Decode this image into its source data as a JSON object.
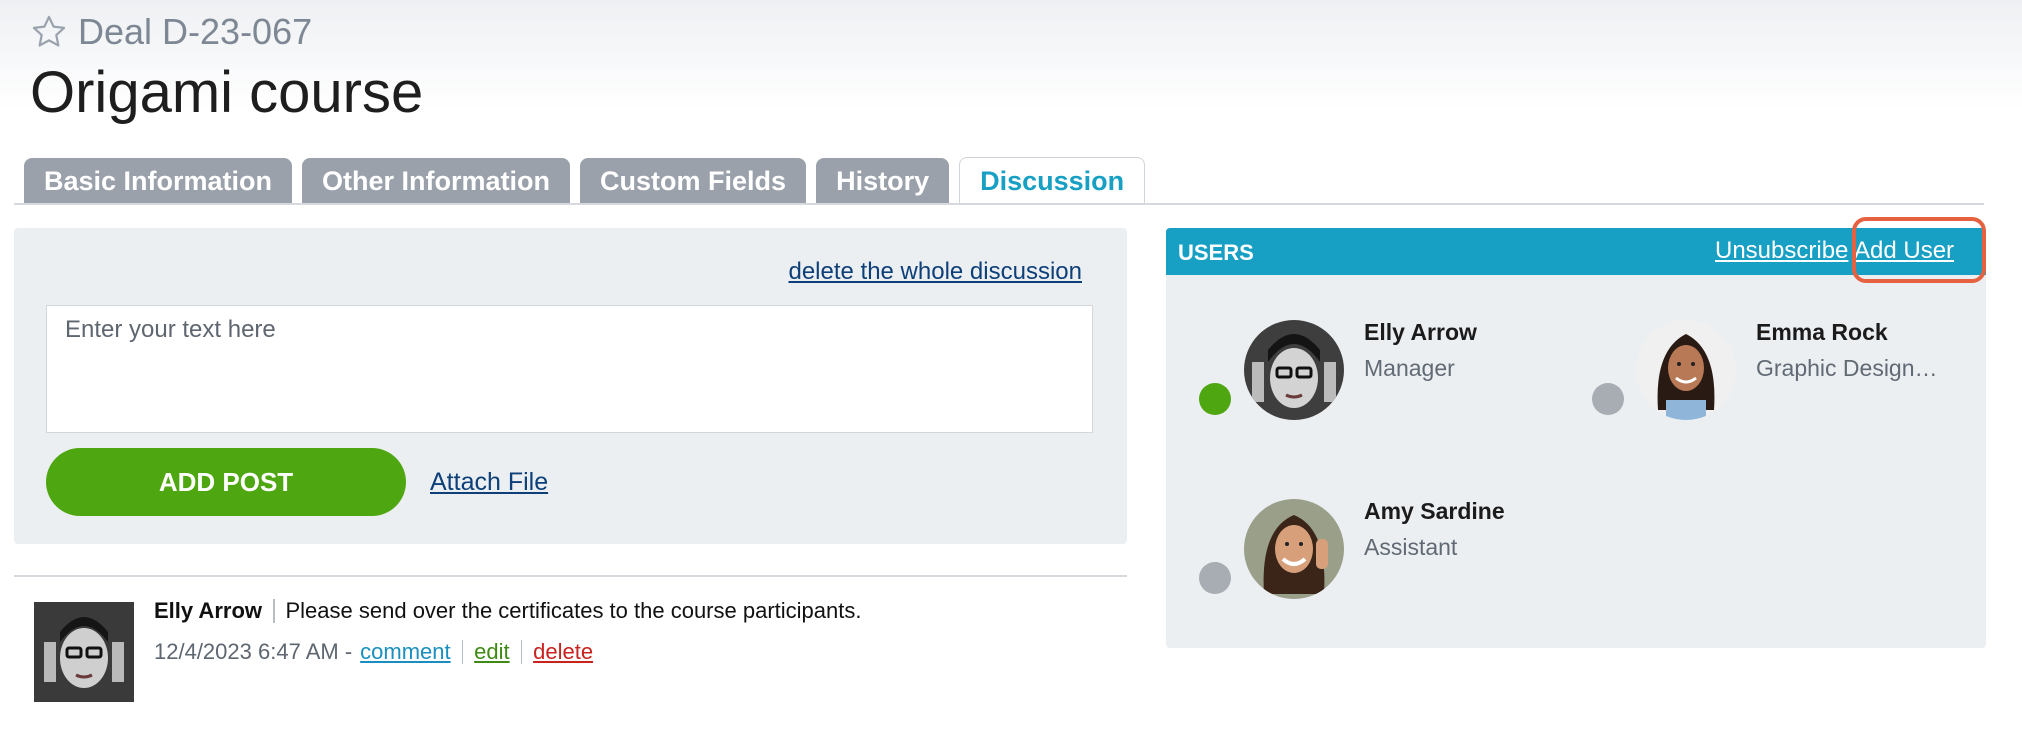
{
  "header": {
    "deal_id": "Deal D-23-067",
    "title": "Origami course"
  },
  "tabs": [
    {
      "label": "Basic Information",
      "active": false
    },
    {
      "label": "Other Information",
      "active": false
    },
    {
      "label": "Custom Fields",
      "active": false
    },
    {
      "label": "History",
      "active": false
    },
    {
      "label": "Discussion",
      "active": true
    }
  ],
  "discussion": {
    "delete_all_label": "delete the whole discussion",
    "input_placeholder": "Enter your text here",
    "add_post_label": "ADD POST",
    "attach_file_label": "Attach File"
  },
  "posts": [
    {
      "author": "Elly Arrow",
      "text": "Please send over the certificates to the course participants.",
      "timestamp": "12/4/2023 6:47 AM -",
      "comment_label": "comment",
      "edit_label": "edit",
      "delete_label": "delete"
    }
  ],
  "users_panel": {
    "title": "USERS",
    "unsubscribe_label": "Unsubscribe",
    "add_user_label": "Add User",
    "users": [
      {
        "name": "Elly Arrow",
        "role": "Manager",
        "status": "online",
        "status_color": "#4ea611"
      },
      {
        "name": "Emma Rock",
        "role": "Graphic Design…",
        "status": "offline",
        "status_color": "#a8adb3"
      },
      {
        "name": "Amy Sardine",
        "role": "Assistant",
        "status": "offline",
        "status_color": "#a8adb3"
      }
    ]
  },
  "colors": {
    "accent": "#189fc4",
    "primary_button": "#4ea611",
    "highlight": "#e5613f",
    "tab_inactive": "#9aa1ab"
  }
}
